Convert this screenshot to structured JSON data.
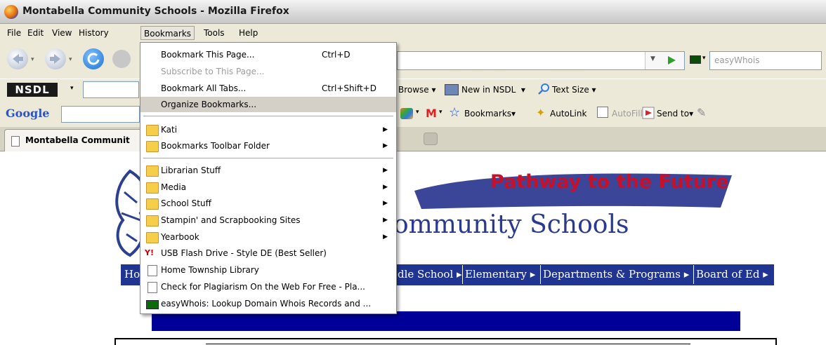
{
  "window": {
    "title": "Montabella Community Schools - Mozilla Firefox"
  },
  "menubar": [
    "File",
    "Edit",
    "View",
    "History",
    "Bookmarks",
    "Tools",
    "Help"
  ],
  "search": {
    "placeholder": "easyWhois"
  },
  "nsdl": {
    "logo": "NSDL",
    "browse": "Browse",
    "new_in": "New in NSDL",
    "text_size": "Text Size"
  },
  "google": {
    "logo": "Google",
    "bookmarks": "Bookmarks",
    "autolink": "AutoLink",
    "autofill": "AutoFill",
    "sendto": "Send to"
  },
  "tabs": {
    "active_label": "Montabella Communit"
  },
  "page": {
    "banner_slogan": "Pathway to the Future",
    "banner_name": "ommunity Schools",
    "nav": {
      "first": "Ho",
      "middle_school": "dle School",
      "elementary": "Elementary",
      "departments": "Departments & Programs",
      "board": "Board of Ed"
    }
  },
  "bookmarks_menu": {
    "bookmark_page": "Bookmark This Page...",
    "bookmark_page_shortcut": "Ctrl+D",
    "subscribe": "Subscribe to This Page...",
    "bookmark_all": "Bookmark All Tabs...",
    "bookmark_all_shortcut": "Ctrl+Shift+D",
    "organize": "Organize Bookmarks...",
    "kati": "Kati",
    "toolbar_folder": "Bookmarks Toolbar Folder",
    "librarian": "Librarian Stuff",
    "media": "Media",
    "school": "School Stuff",
    "stampin": "Stampin' and Scrapbooking Sites",
    "yearbook": "Yearbook",
    "usb": "USB Flash Drive - Style DE (Best Seller)",
    "home_township": "Home Township Library",
    "plagiarism": "Check for Plagiarism On the Web For Free - Pla...",
    "easywhois": "easyWhois: Lookup Domain Whois Records and ..."
  }
}
